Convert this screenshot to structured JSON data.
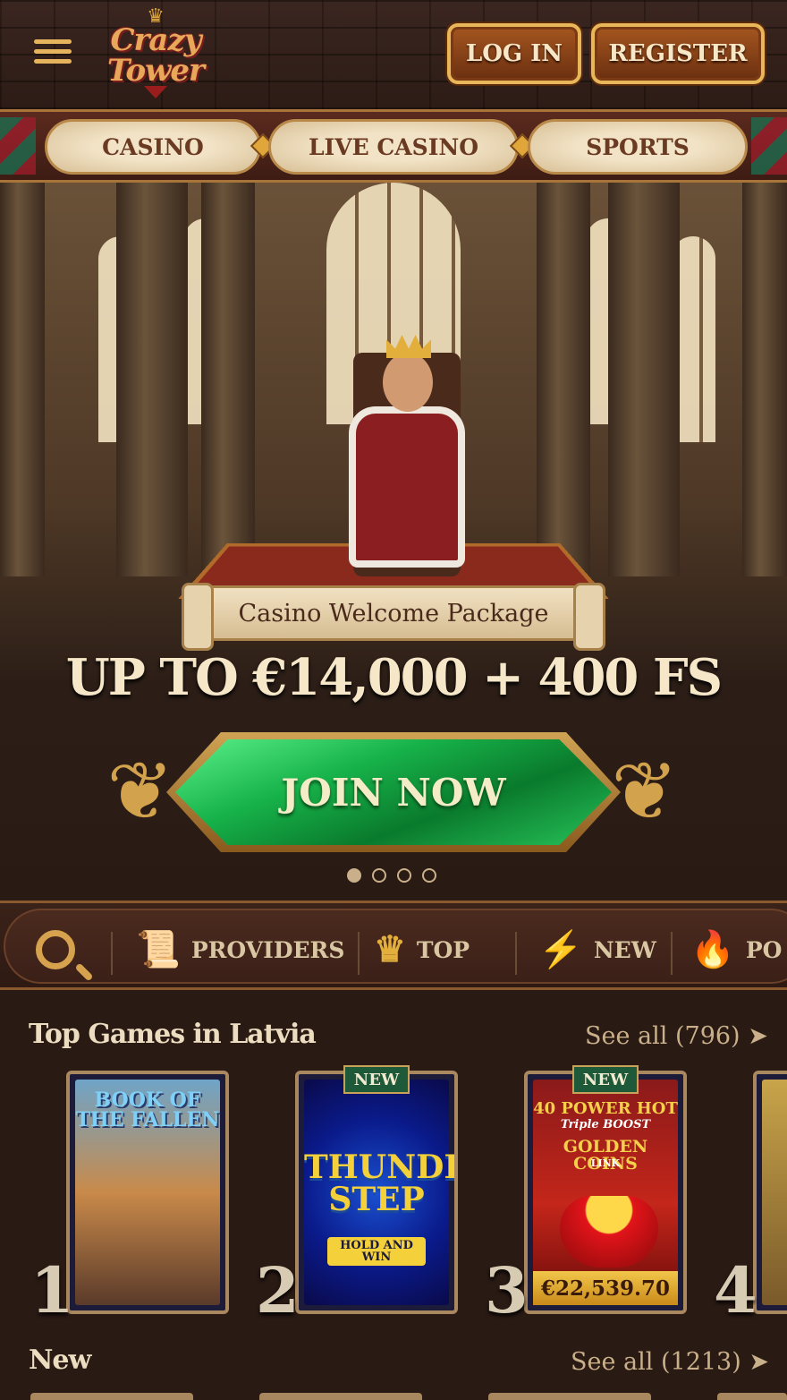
{
  "header": {
    "logo_line1": "Crazy",
    "logo_line2": "Tower",
    "login_label": "LOG IN",
    "register_label": "REGISTER"
  },
  "nav": {
    "tabs": [
      {
        "label": "CASINO"
      },
      {
        "label": "LIVE CASINO"
      },
      {
        "label": "SPORTS"
      }
    ]
  },
  "hero": {
    "banner": "Casino Welcome Package",
    "promo": "UP TO €14,000 + 400 FS",
    "cta": "JOIN NOW",
    "slides": 4,
    "active_slide": 1
  },
  "categories": [
    {
      "label": "PROVIDERS",
      "icon": "scroll-seal-icon"
    },
    {
      "label": "TOP",
      "icon": "crown-icon"
    },
    {
      "label": "NEW",
      "icon": "lightning-icon"
    },
    {
      "label": "PO",
      "icon": "fire-icon"
    }
  ],
  "top_games": {
    "title": "Top Games in Latvia",
    "see_all": "See all (796)",
    "games": [
      {
        "rank": "1",
        "title": "BOOK OF THE FALLEN",
        "badge": "",
        "jackpot": ""
      },
      {
        "rank": "2",
        "title": "THUNDER STEP",
        "subtitle": "HOLD AND WIN",
        "badge": "NEW",
        "jackpot": ""
      },
      {
        "rank": "3",
        "title": "40 POWER HOT",
        "subtitle": "Triple BOOST",
        "subtitle2": "GOLDEN COINS",
        "subtitle3": "LINK",
        "badge": "NEW",
        "jackpot": "€22,539.70"
      },
      {
        "rank": "4",
        "title": "",
        "badge": "",
        "jackpot": ""
      }
    ]
  },
  "new_games": {
    "title": "New",
    "see_all": "See all (1213)"
  },
  "colors": {
    "background": "#2a1a14",
    "gold": "#e8b75a",
    "green_cta": "#17b24a",
    "text_light": "#f2e2c4"
  }
}
